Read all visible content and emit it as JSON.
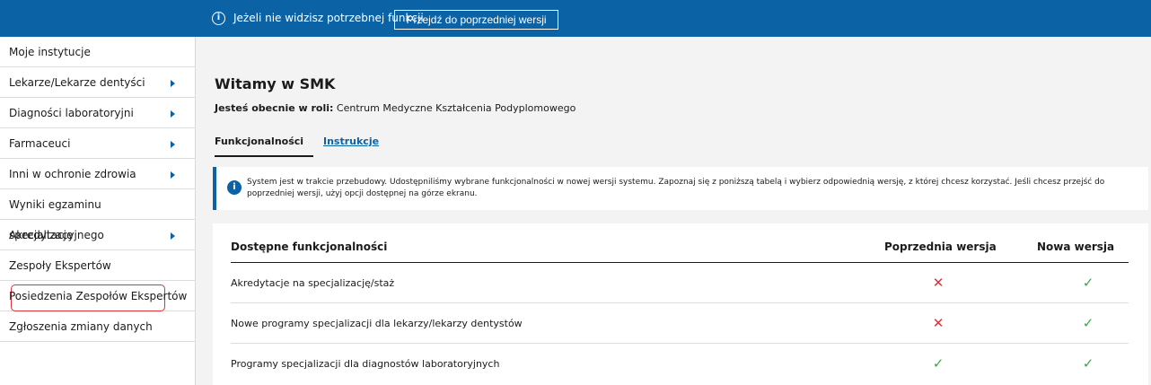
{
  "topbar": {
    "notice": "Jeżeli nie widzisz potrzebnej funkcji",
    "prev_button": "Przejdź do poprzedniej wersji",
    "info_icon": "i"
  },
  "sidebar": {
    "items": [
      {
        "label": "Moje instytucje",
        "arrow": false
      },
      {
        "label": "Lekarze/Lekarze dentyści",
        "arrow": true
      },
      {
        "label": "Diagności laboratoryjni",
        "arrow": true
      },
      {
        "label": "Farmaceuci",
        "arrow": true
      },
      {
        "label": "Inni w ochronie zdrowia",
        "arrow": true
      },
      {
        "label": "Wyniki egzaminu specjalizacyjnego",
        "arrow": false
      },
      {
        "label": "Akredytacje",
        "arrow": true
      },
      {
        "label": "Zespoły Ekspertów",
        "arrow": false
      },
      {
        "label": "Posiedzenia Zespołów Ekspertów",
        "arrow": false,
        "highlighted": true
      },
      {
        "label": "Zgłoszenia zmiany danych",
        "arrow": false
      }
    ]
  },
  "main": {
    "title": "Witamy w SMK",
    "role_label": "Jesteś obecnie w roli:",
    "role_value": " Centrum Medyczne Kształcenia Podyplomowego",
    "tabs": [
      {
        "label": "Funkcjonalności",
        "active": true
      },
      {
        "label": "Instrukcje",
        "active": false
      }
    ],
    "alert": {
      "icon": "i",
      "text": "System jest w trakcie przebudowy. Udostępniliśmy wybrane funkcjonalności w nowej wersji systemu. Zapoznaj się z poniższą tabelą i wybierz odpowiednią wersję, z której chcesz korzystać. Jeśli chcesz przejść do poprzedniej wersji, użyj opcji dostępnej na górze ekranu."
    },
    "table": {
      "headers": [
        "Dostępne funkcjonalności",
        "Poprzednia wersja",
        "Nowa wersja"
      ],
      "rows": [
        {
          "label": "Akredytacje na specjalizację/staż",
          "prev": "✕",
          "next": "✓"
        },
        {
          "label": "Nowe programy specjalizacji dla lekarzy/lekarzy dentystów",
          "prev": "✕",
          "next": "✓"
        },
        {
          "label": "Programy specjalizacji dla diagnostów laboratoryjnych",
          "prev": "✓",
          "next": "✓"
        }
      ]
    }
  },
  "colors": {
    "brand": "#0b63a6",
    "no": "#e0303a",
    "yes": "#3aa94a",
    "highlight": "#e0303a"
  }
}
